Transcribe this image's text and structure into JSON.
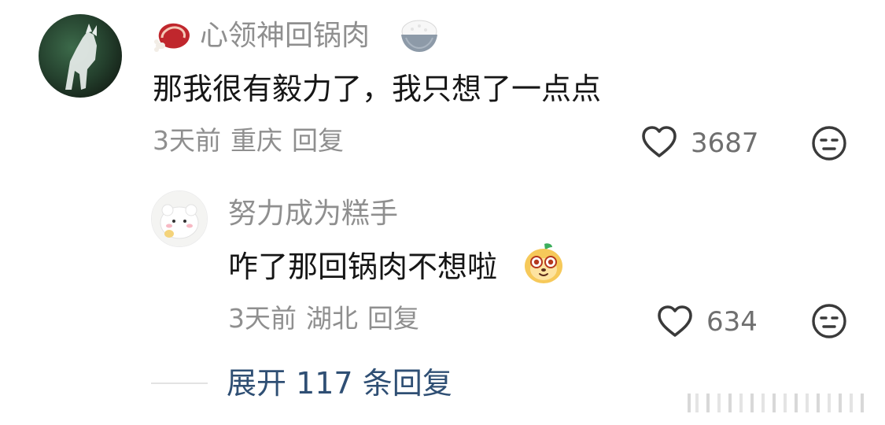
{
  "comment": {
    "username": "心领神回锅肉",
    "text": "那我很有毅力了，我只想了一点点",
    "time": "3天前",
    "location": "重庆",
    "reply_label": "回复",
    "likes": "3687"
  },
  "reply": {
    "username": "努力成为糕手",
    "text": "咋了那回锅肉不想啦",
    "time": "3天前",
    "location": "湖北",
    "reply_label": "回复",
    "likes": "634"
  },
  "expand": {
    "label": "展开 117 条回复"
  },
  "icons": {
    "like": "heart-outline-icon",
    "dislike": "neutral-face-icon",
    "meat_emoji": "steak-emoji",
    "rice_emoji": "rice-bowl-emoji",
    "dog_emoji": "dog-face-emoji"
  },
  "colors": {
    "username": "#8f8f8f",
    "text": "#161616",
    "meta": "#8f8f8f",
    "link": "#2f4f74"
  }
}
